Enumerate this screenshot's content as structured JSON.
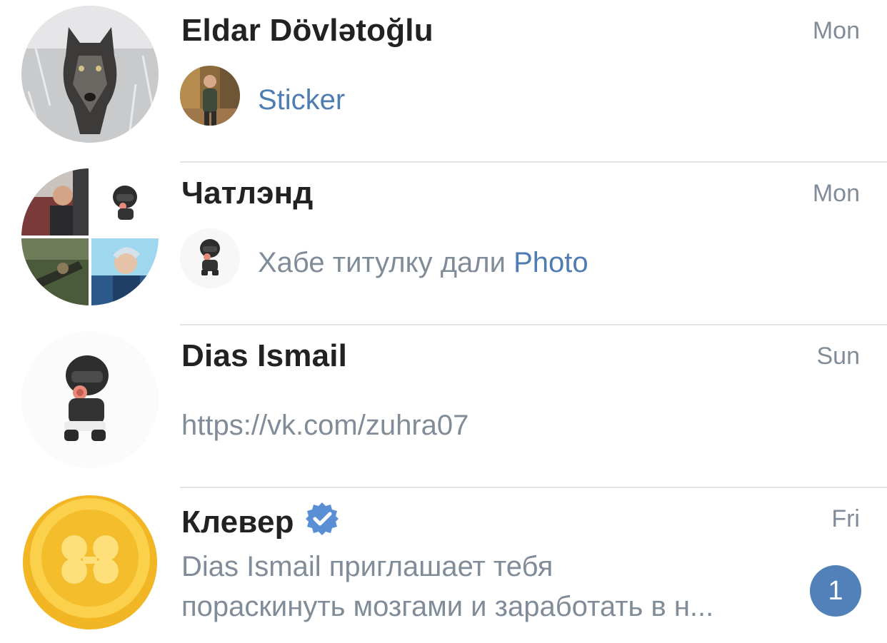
{
  "chats": [
    {
      "name": "Eldar Dövlətoğlu",
      "time": "Mon",
      "preview_text": "",
      "preview_accent": "Sticker",
      "avatar_icon": "wolf-photo-avatar",
      "thumb_icon": "user-photo-thumbnail"
    },
    {
      "name": "Чатлэнд",
      "time": "Mon",
      "preview_text": "Хабе титулку дали ",
      "preview_accent": "Photo",
      "avatar_icon": "group-collage-avatar",
      "thumb_icon": "sticker-thumbnail"
    },
    {
      "name": "Dias Ismail",
      "time": "Sun",
      "preview_text": "https://vk.com/zuhra07",
      "avatar_icon": "sticker-character-avatar"
    },
    {
      "name": "Клевер",
      "time": "Fri",
      "preview_line1": "Dias Ismail приглашает тебя",
      "preview_line2": "пораскинуть мозгами и заработать в н...",
      "unread_count": "1",
      "verified": true,
      "avatar_icon": "clover-coin-avatar"
    }
  ],
  "colors": {
    "accent": "#4f7db3",
    "muted": "#818c99",
    "badge": "#5181b8",
    "verified": "#5a8fd6"
  }
}
